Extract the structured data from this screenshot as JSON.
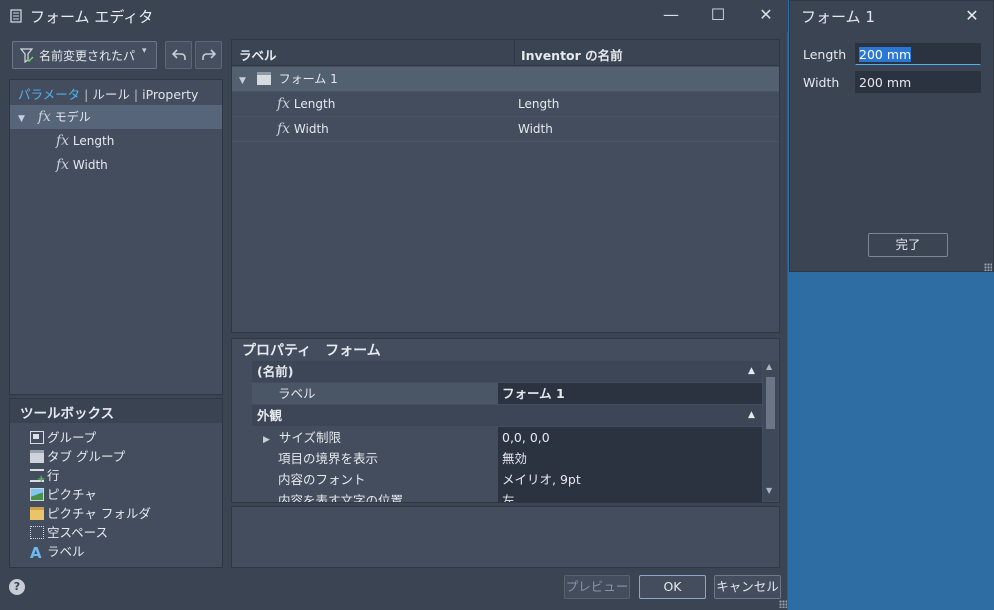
{
  "window": {
    "title": "フォーム エディタ",
    "minimize_glyph": "—",
    "maximize_glyph": "☐",
    "close_glyph": "✕"
  },
  "left": {
    "dropdown_label": "名前変更されたパ",
    "tabs": [
      "パラメータ",
      "ルール",
      "iProperty"
    ],
    "tree": {
      "root": "モデル",
      "children": [
        "Length",
        "Width"
      ]
    },
    "toolbox_title": "ツールボックス",
    "toolbox_items": [
      "グループ",
      "タブ グループ",
      "行",
      "ピクチャ",
      "ピクチャ フォルダ",
      "空スペース",
      "ラベル"
    ]
  },
  "grid": {
    "columns": [
      "ラベル",
      "Inventor の名前"
    ],
    "form_name": "フォーム 1",
    "rows": [
      {
        "label": "Length",
        "name": "Length"
      },
      {
        "label": "Width",
        "name": "Width"
      }
    ]
  },
  "properties": {
    "title": "プロパティ　フォーム",
    "category_name": "(名前)",
    "label_key": "ラベル",
    "label_value": "フォーム 1",
    "category_appearance": "外観",
    "rows": [
      {
        "key": "サイズ制限",
        "value": "0,0, 0,0"
      },
      {
        "key": "項目の境界を表示",
        "value": "無効"
      },
      {
        "key": "内容のフォント",
        "value": "メイリオ, 9pt"
      },
      {
        "key": "内容を表す文字の位置",
        "value": "左"
      }
    ]
  },
  "buttons": {
    "preview": "プレビュー",
    "ok": "OK",
    "cancel": "キャンセル",
    "help": "?"
  },
  "form_window": {
    "title": "フォーム 1",
    "close_glyph": "✕",
    "fields": [
      {
        "label": "Length",
        "value": "200 mm"
      },
      {
        "label": "Width",
        "value": "200 mm"
      }
    ],
    "done_label": "完了"
  },
  "colors": {
    "accent": "#4fb1f2",
    "panel": "#434d5d",
    "window": "#3b4453",
    "desktop": "#2e6da4"
  }
}
